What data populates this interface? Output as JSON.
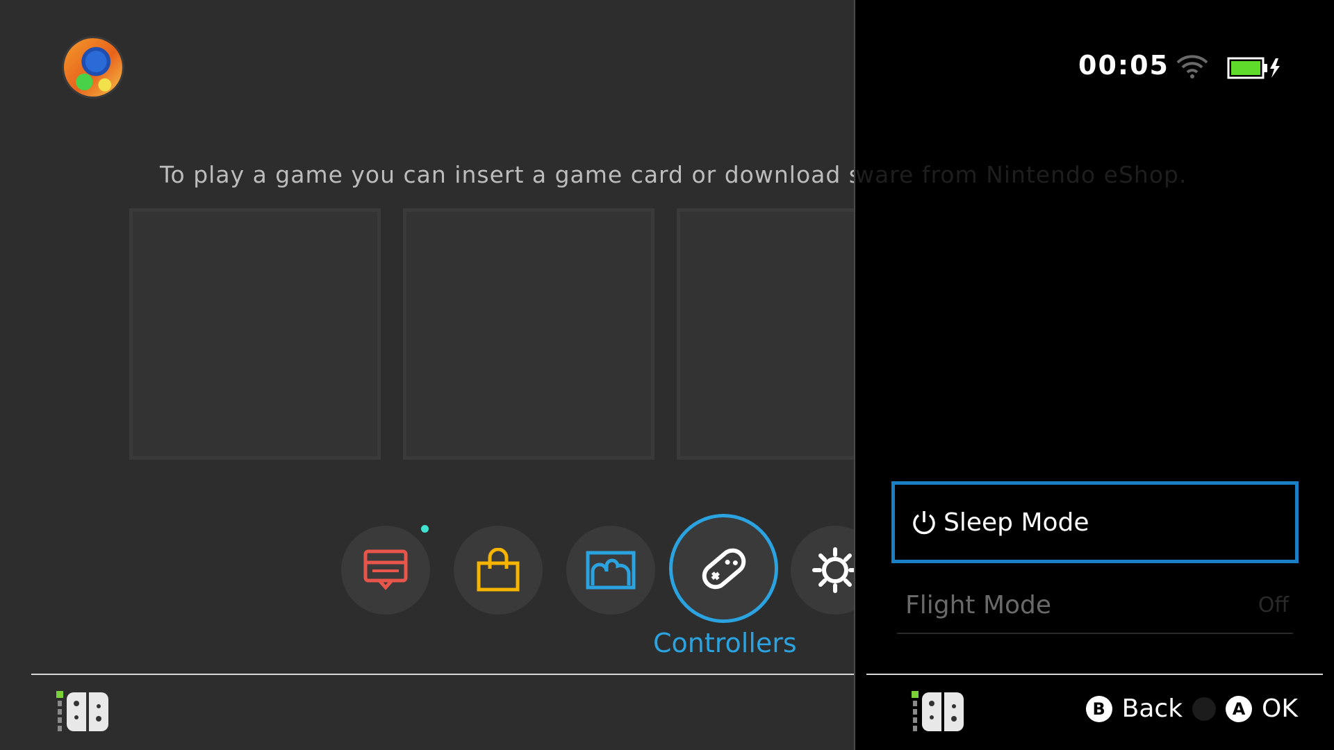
{
  "home": {
    "hint": "To play a game you can insert a game card or download software from Nintendo eShop.",
    "dock": [
      {
        "name": "news",
        "icon": "news-icon",
        "color": "#e8554a"
      },
      {
        "name": "eshop",
        "icon": "shopping-bag-icon",
        "color": "#f4b400"
      },
      {
        "name": "album",
        "icon": "album-icon",
        "color": "#2ba3e0"
      },
      {
        "name": "controllers",
        "icon": "controller-icon",
        "color": "#ffffff"
      },
      {
        "name": "system-settings",
        "icon": "gear-icon",
        "color": "#ffffff"
      }
    ],
    "selected_label": "Controllers"
  },
  "status": {
    "time": "00:05",
    "battery_level": 1.0,
    "charging": true
  },
  "power_menu": {
    "sleep_label": "Sleep Mode",
    "flight_label": "Flight Mode",
    "flight_value": "Off"
  },
  "footer": {
    "back_key": "B",
    "back_label": "Back",
    "ok_key": "A",
    "ok_label": "OK"
  },
  "colors": {
    "accent": "#2ba3e0",
    "highlight_border": "#1a7fc4",
    "battery": "#5fdc2a"
  }
}
